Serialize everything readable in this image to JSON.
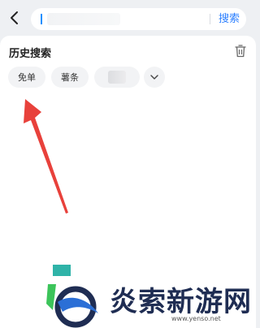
{
  "header": {
    "back_icon": "chevron-left-icon",
    "search": {
      "value": "",
      "placeholder": "",
      "action_label": "搜索"
    }
  },
  "history": {
    "title": "历史搜索",
    "clear_icon": "trash-icon",
    "chips": [
      {
        "label": "免单"
      },
      {
        "label": "薯条"
      },
      {
        "label": ""
      }
    ],
    "expand_icon": "chevron-down-icon"
  },
  "annotation": {
    "arrow_color": "#e8413b"
  },
  "watermark": {
    "text": "炎索新游网",
    "url": "www.yenso.net"
  },
  "colors": {
    "accent": "#2b7fff",
    "background": "#eef0f3",
    "chip_bg": "#f2f3f5"
  }
}
